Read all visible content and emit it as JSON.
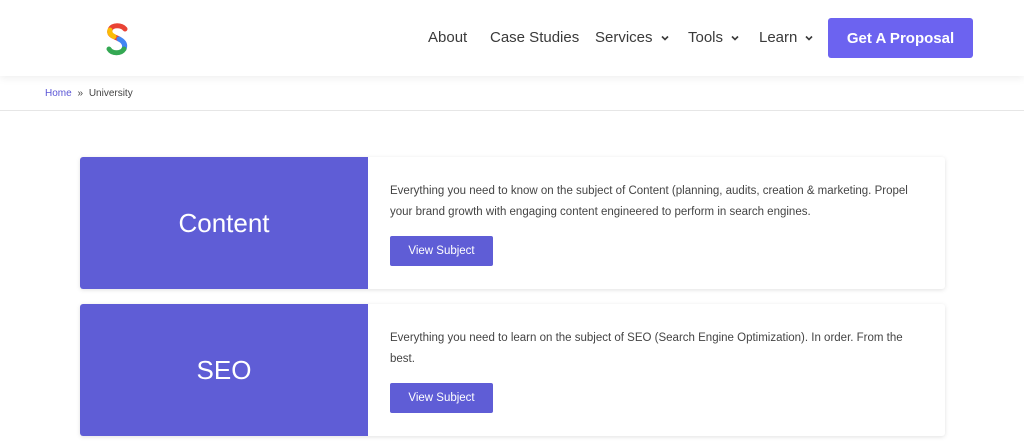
{
  "header": {
    "logo_icon": "brand-s-logo",
    "nav": {
      "about": "About",
      "case_studies": "Case Studies",
      "services": "Services",
      "tools": "Tools",
      "learn": "Learn"
    },
    "cta_label": "Get A Proposal",
    "cta_color": "#6c63f0"
  },
  "breadcrumb": {
    "home": "Home",
    "separator": "»",
    "current": "University"
  },
  "subjects": [
    {
      "title": "Content",
      "description": "Everything you need to know on the subject of Content (planning, audits, creation & marketing. Propel your brand growth with engaging content engineered to perform in search engines.",
      "button_label": "View Subject"
    },
    {
      "title": "SEO",
      "description": "Everything you need to learn on the subject of SEO (Search Engine Optimization). In order. From the best.",
      "button_label": "View Subject"
    }
  ],
  "colors": {
    "accent": "#5f5dd6",
    "link": "#5a55d6"
  }
}
